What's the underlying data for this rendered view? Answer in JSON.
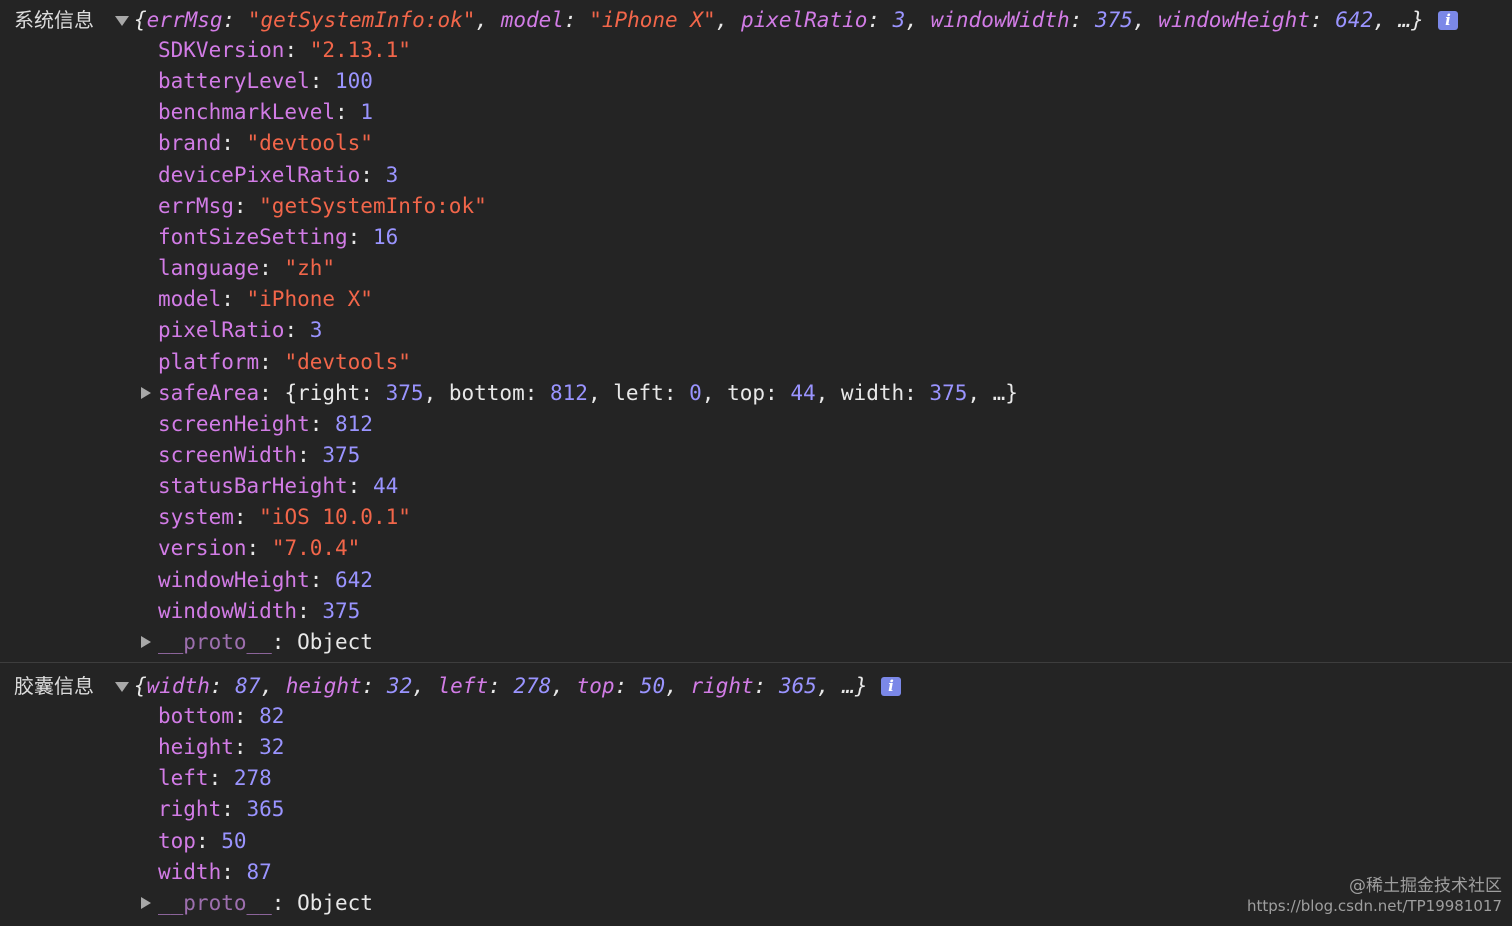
{
  "console": {
    "entries": [
      {
        "label": "系统信息",
        "summary": [
          {
            "t": "p",
            "v": "{"
          },
          {
            "t": "k",
            "v": "errMsg"
          },
          {
            "t": "p",
            "v": ": "
          },
          {
            "t": "s",
            "v": "\"getSystemInfo:ok\""
          },
          {
            "t": "p",
            "v": ", "
          },
          {
            "t": "k",
            "v": "model"
          },
          {
            "t": "p",
            "v": ": "
          },
          {
            "t": "s",
            "v": "\"iPhone X\""
          },
          {
            "t": "p",
            "v": ", "
          },
          {
            "t": "k",
            "v": "pixelRatio"
          },
          {
            "t": "p",
            "v": ": "
          },
          {
            "t": "n",
            "v": "3"
          },
          {
            "t": "p",
            "v": ", "
          },
          {
            "t": "k",
            "v": "windowWidth"
          },
          {
            "t": "p",
            "v": ": "
          },
          {
            "t": "n",
            "v": "375"
          },
          {
            "t": "p",
            "v": ", "
          },
          {
            "t": "k",
            "v": "windowHeight"
          },
          {
            "t": "p",
            "v": ": "
          },
          {
            "t": "n",
            "v": "642"
          },
          {
            "t": "p",
            "v": ", …}"
          }
        ],
        "info_badge": "i",
        "properties": [
          {
            "key": "SDKVersion",
            "value": "\"2.13.1\"",
            "type": "string"
          },
          {
            "key": "batteryLevel",
            "value": "100",
            "type": "number"
          },
          {
            "key": "benchmarkLevel",
            "value": "1",
            "type": "number"
          },
          {
            "key": "brand",
            "value": "\"devtools\"",
            "type": "string"
          },
          {
            "key": "devicePixelRatio",
            "value": "3",
            "type": "number"
          },
          {
            "key": "errMsg",
            "value": "\"getSystemInfo:ok\"",
            "type": "string"
          },
          {
            "key": "fontSizeSetting",
            "value": "16",
            "type": "number"
          },
          {
            "key": "language",
            "value": "\"zh\"",
            "type": "string"
          },
          {
            "key": "model",
            "value": "\"iPhone X\"",
            "type": "string"
          },
          {
            "key": "pixelRatio",
            "value": "3",
            "type": "number"
          },
          {
            "key": "platform",
            "value": "\"devtools\"",
            "type": "string"
          },
          {
            "key": "safeArea",
            "type": "object",
            "expandable": true,
            "preview": [
              {
                "t": "p",
                "v": "{"
              },
              {
                "t": "p",
                "v": "right"
              },
              {
                "t": "p",
                "v": ": "
              },
              {
                "t": "n",
                "v": "375"
              },
              {
                "t": "p",
                "v": ", "
              },
              {
                "t": "p",
                "v": "bottom"
              },
              {
                "t": "p",
                "v": ": "
              },
              {
                "t": "n",
                "v": "812"
              },
              {
                "t": "p",
                "v": ", "
              },
              {
                "t": "p",
                "v": "left"
              },
              {
                "t": "p",
                "v": ": "
              },
              {
                "t": "n",
                "v": "0"
              },
              {
                "t": "p",
                "v": ", "
              },
              {
                "t": "p",
                "v": "top"
              },
              {
                "t": "p",
                "v": ": "
              },
              {
                "t": "n",
                "v": "44"
              },
              {
                "t": "p",
                "v": ", "
              },
              {
                "t": "p",
                "v": "width"
              },
              {
                "t": "p",
                "v": ": "
              },
              {
                "t": "n",
                "v": "375"
              },
              {
                "t": "p",
                "v": ", …}"
              }
            ]
          },
          {
            "key": "screenHeight",
            "value": "812",
            "type": "number"
          },
          {
            "key": "screenWidth",
            "value": "375",
            "type": "number"
          },
          {
            "key": "statusBarHeight",
            "value": "44",
            "type": "number"
          },
          {
            "key": "system",
            "value": "\"iOS 10.0.1\"",
            "type": "string"
          },
          {
            "key": "version",
            "value": "\"7.0.4\"",
            "type": "string"
          },
          {
            "key": "windowHeight",
            "value": "642",
            "type": "number"
          },
          {
            "key": "windowWidth",
            "value": "375",
            "type": "number"
          },
          {
            "key": "__proto__",
            "value": "Object",
            "type": "proto",
            "expandable": true
          }
        ]
      },
      {
        "label": "胶囊信息",
        "summary": [
          {
            "t": "p",
            "v": "{"
          },
          {
            "t": "k",
            "v": "width"
          },
          {
            "t": "p",
            "v": ": "
          },
          {
            "t": "n",
            "v": "87"
          },
          {
            "t": "p",
            "v": ", "
          },
          {
            "t": "k",
            "v": "height"
          },
          {
            "t": "p",
            "v": ": "
          },
          {
            "t": "n",
            "v": "32"
          },
          {
            "t": "p",
            "v": ", "
          },
          {
            "t": "k",
            "v": "left"
          },
          {
            "t": "p",
            "v": ": "
          },
          {
            "t": "n",
            "v": "278"
          },
          {
            "t": "p",
            "v": ", "
          },
          {
            "t": "k",
            "v": "top"
          },
          {
            "t": "p",
            "v": ": "
          },
          {
            "t": "n",
            "v": "50"
          },
          {
            "t": "p",
            "v": ", "
          },
          {
            "t": "k",
            "v": "right"
          },
          {
            "t": "p",
            "v": ": "
          },
          {
            "t": "n",
            "v": "365"
          },
          {
            "t": "p",
            "v": ", …}"
          }
        ],
        "info_badge": "i",
        "properties": [
          {
            "key": "bottom",
            "value": "82",
            "type": "number"
          },
          {
            "key": "height",
            "value": "32",
            "type": "number"
          },
          {
            "key": "left",
            "value": "278",
            "type": "number"
          },
          {
            "key": "right",
            "value": "365",
            "type": "number"
          },
          {
            "key": "top",
            "value": "50",
            "type": "number"
          },
          {
            "key": "width",
            "value": "87",
            "type": "number"
          },
          {
            "key": "__proto__",
            "value": "Object",
            "type": "proto",
            "expandable": true
          }
        ]
      }
    ]
  },
  "watermark": {
    "line1": "@稀土掘金技术社区",
    "line2": "https://blog.csdn.net/TP19981017"
  },
  "colors": {
    "background": "#242424",
    "key": "#d27ce6",
    "number": "#9a94ff",
    "string": "#f2664a",
    "info_badge": "#7b88e8"
  }
}
